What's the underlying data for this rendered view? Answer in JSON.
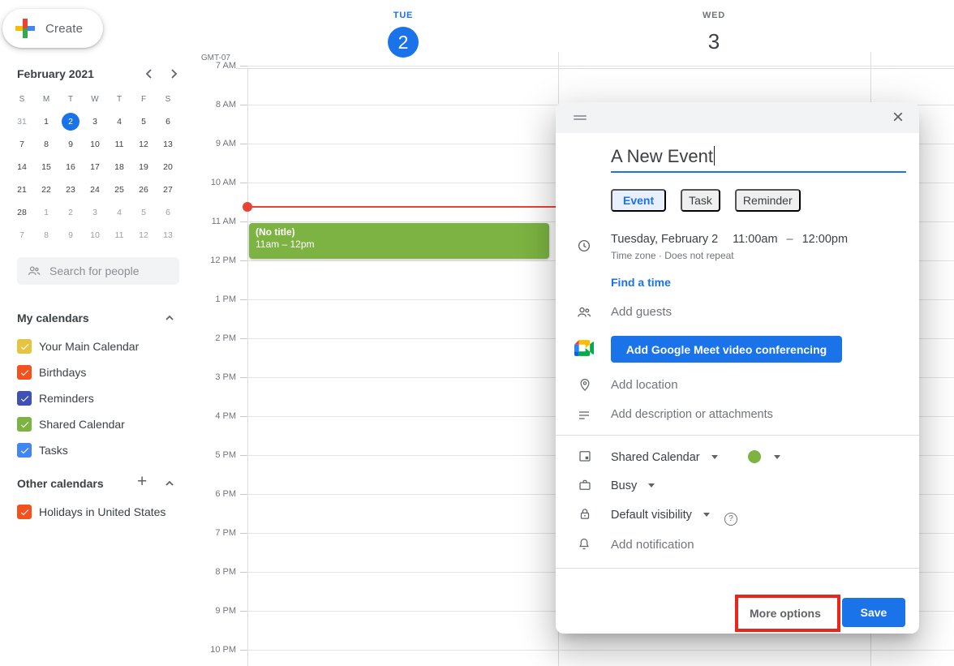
{
  "sidebar": {
    "create_label": "Create",
    "search_placeholder": "Search for people",
    "mini_calendar": {
      "title": "February 2021",
      "weekdays": [
        "S",
        "M",
        "T",
        "W",
        "T",
        "F",
        "S"
      ],
      "days": [
        {
          "label": "31",
          "muted": true
        },
        {
          "label": "1"
        },
        {
          "label": "2",
          "selected": true
        },
        {
          "label": "3"
        },
        {
          "label": "4"
        },
        {
          "label": "5"
        },
        {
          "label": "6"
        },
        {
          "label": "7"
        },
        {
          "label": "8"
        },
        {
          "label": "9"
        },
        {
          "label": "10"
        },
        {
          "label": "11"
        },
        {
          "label": "12"
        },
        {
          "label": "13"
        },
        {
          "label": "14"
        },
        {
          "label": "15"
        },
        {
          "label": "16"
        },
        {
          "label": "17"
        },
        {
          "label": "18"
        },
        {
          "label": "19"
        },
        {
          "label": "20"
        },
        {
          "label": "21"
        },
        {
          "label": "22"
        },
        {
          "label": "23"
        },
        {
          "label": "24"
        },
        {
          "label": "25"
        },
        {
          "label": "26"
        },
        {
          "label": "27"
        },
        {
          "label": "28"
        },
        {
          "label": "1",
          "muted": true
        },
        {
          "label": "2",
          "muted": true
        },
        {
          "label": "3",
          "muted": true
        },
        {
          "label": "4",
          "muted": true
        },
        {
          "label": "5",
          "muted": true
        },
        {
          "label": "6",
          "muted": true
        },
        {
          "label": "7",
          "muted": true
        },
        {
          "label": "8",
          "muted": true
        },
        {
          "label": "9",
          "muted": true
        },
        {
          "label": "10",
          "muted": true
        },
        {
          "label": "11",
          "muted": true
        },
        {
          "label": "12",
          "muted": true
        },
        {
          "label": "13",
          "muted": true
        }
      ]
    },
    "my_calendars": {
      "title": "My calendars",
      "items": [
        {
          "label": "Your Main Calendar",
          "color": "#e4c441"
        },
        {
          "label": "Birthdays",
          "color": "#f4511e"
        },
        {
          "label": "Reminders",
          "color": "#3f51b5"
        },
        {
          "label": "Shared Calendar",
          "color": "#7cb342"
        },
        {
          "label": "Tasks",
          "color": "#4285f4"
        }
      ]
    },
    "other_calendars": {
      "title": "Other calendars",
      "items": [
        {
          "label": "Holidays in United States",
          "color": "#f4511e"
        }
      ]
    }
  },
  "calendar_view": {
    "gmt_label": "GMT-07",
    "day_headers": [
      {
        "weekday": "TUE",
        "day": "2",
        "is_today": true
      },
      {
        "weekday": "WED",
        "day": "3",
        "is_today": false
      }
    ],
    "hours": [
      "7 AM",
      "8 AM",
      "9 AM",
      "10 AM",
      "11 AM",
      "12 PM",
      "1 PM",
      "2 PM",
      "3 PM",
      "4 PM",
      "5 PM",
      "6 PM",
      "7 PM",
      "8 PM",
      "9 PM",
      "10 PM"
    ],
    "event": {
      "title": "(No title)",
      "time_range": "11am – 12pm",
      "color": "#7cb342"
    },
    "now_line_color": "#ea4335"
  },
  "dialog": {
    "title_value": "A New Event",
    "tabs": [
      {
        "label": "Event",
        "active": true
      },
      {
        "label": "Task",
        "active": false
      },
      {
        "label": "Reminder",
        "active": false
      }
    ],
    "datetime": {
      "date": "Tuesday, February 2",
      "start_time": "11:00am",
      "separator": "–",
      "end_time": "12:00pm",
      "subtext": "Time zone · Does not repeat"
    },
    "find_a_time_label": "Find a time",
    "add_guests_placeholder": "Add guests",
    "meet_button_label": "Add Google Meet video conferencing",
    "add_location_placeholder": "Add location",
    "add_description_placeholder": "Add description or attachments",
    "calendar_name": "Shared Calendar",
    "calendar_color": "#7cb342",
    "busy_label": "Busy",
    "visibility_label": "Default visibility",
    "help_glyph": "?",
    "notification_label": "Add notification",
    "more_options_label": "More options",
    "save_label": "Save",
    "close_glyph": "×"
  },
  "colors": {
    "accent": "#1a73e8",
    "annotation": "#e8261c"
  }
}
